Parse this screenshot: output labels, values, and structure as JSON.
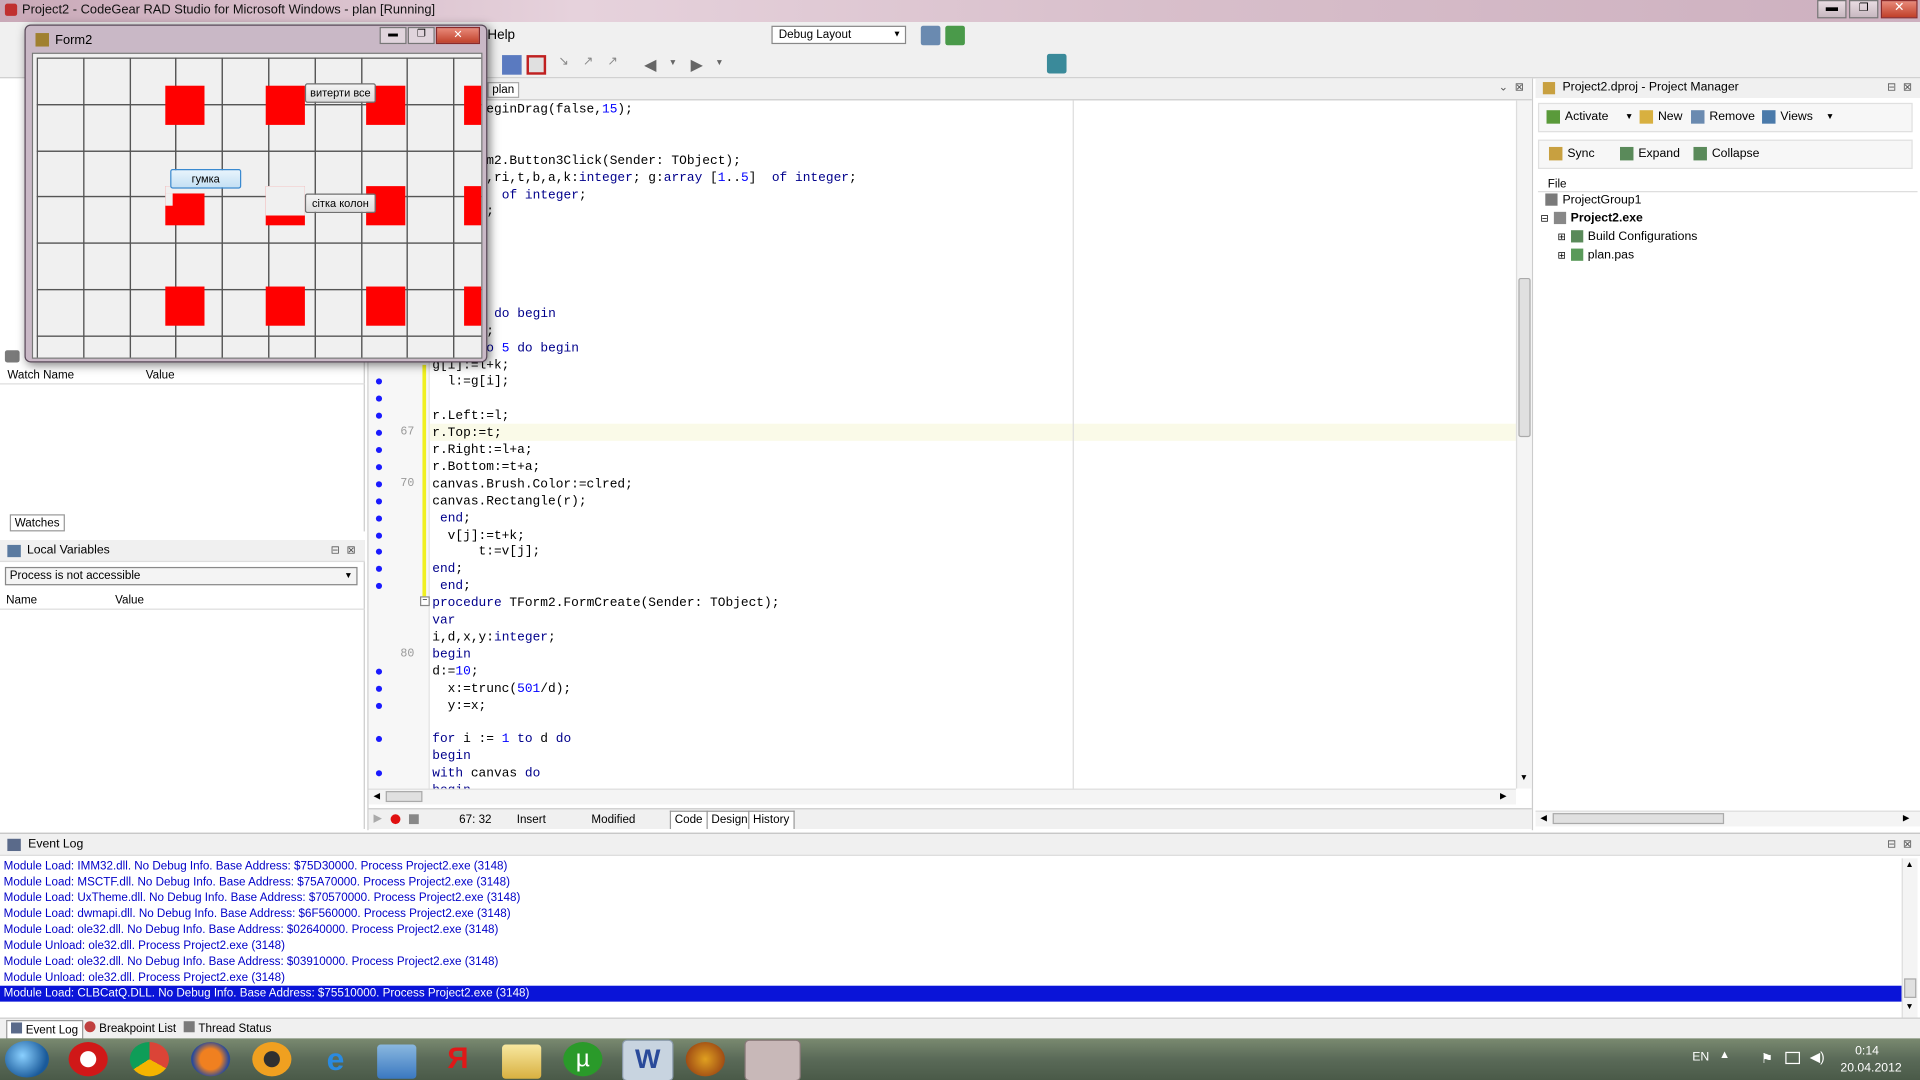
{
  "window": {
    "title": "Project2 - CodeGear RAD Studio for Microsoft Windows - plan [Running]"
  },
  "menu": {
    "help": "Help"
  },
  "toolbar": {
    "layout_select": "Debug Layout"
  },
  "form2": {
    "title": "Form2",
    "buttons": {
      "wipe_all": "витерти все",
      "rubber": "гумка",
      "grid_columns": "сітка колон"
    }
  },
  "editor": {
    "tab": "plan",
    "gutter_numbers": {
      "l67": "67",
      "l70": "70",
      "l80": "80"
    },
    "lines": [
      "tton2.BeginDrag(false,15);",
      "",
      "",
      "re TForm2.Button3Click(Sender: TObject);",
      "Rect; l,ri,t,b,a,k:integer; g:array [1..5]  of integer;",
      " [1..3]  of integer;",
      "Integer;",
      "",
      "",
      "",
      ";",
      "",
      " 1 to 3 do begin",
      "  l:=30;",
      "I:= 1 to 5 do begin",
      "g[i]:=l+k;",
      "  l:=g[i];",
      "",
      "r.Left:=l;",
      "r.Top:=t;",
      "r.Right:=l+a;",
      "r.Bottom:=t+a;",
      "canvas.Brush.Color:=clred;",
      "canvas.Rectangle(r);",
      " end;",
      "  v[j]:=t+k;",
      "      t:=v[j];",
      "end;",
      " end;",
      "procedure TForm2.FormCreate(Sender: TObject);",
      "var",
      "i,d,x,y:integer;",
      "begin",
      "d:=10;",
      "  x:=trunc(501/d);",
      "  y:=x;",
      "",
      "for i := 1 to d do",
      "begin",
      "with canvas do",
      "begin"
    ],
    "status": {
      "position": "67: 32",
      "mode": "Insert",
      "modified": "Modified"
    },
    "bottom_tabs": [
      "Code",
      "Design",
      "History"
    ]
  },
  "watches": {
    "columns": [
      "Watch Name",
      "Value"
    ],
    "tab": "Watches"
  },
  "local_vars": {
    "title": "Local Variables",
    "select": "Process is not accessible",
    "columns": [
      "Name",
      "Value"
    ]
  },
  "project_manager": {
    "title": "Project2.dproj - Project Manager",
    "toolbar1": [
      "Activate",
      "New",
      "Remove",
      "Views"
    ],
    "toolbar2": [
      "Sync",
      "Expand",
      "Collapse"
    ],
    "header": "File",
    "tree": [
      "ProjectGroup1",
      "Project2.exe",
      "Build Configurations",
      "plan.pas"
    ]
  },
  "event_log": {
    "title": "Event Log",
    "lines": [
      "Module Load: IMM32.dll. No Debug Info. Base Address: $75D30000. Process Project2.exe (3148)",
      "Module Load: MSCTF.dll. No Debug Info. Base Address: $75A70000. Process Project2.exe (3148)",
      "Module Load: UxTheme.dll. No Debug Info. Base Address: $70570000. Process Project2.exe (3148)",
      "Module Load: dwmapi.dll. No Debug Info. Base Address: $6F560000. Process Project2.exe (3148)",
      "Module Load: ole32.dll. No Debug Info. Base Address: $02640000. Process Project2.exe (3148)",
      "Module Unload: ole32.dll. Process Project2.exe (3148)",
      "Module Load: ole32.dll. No Debug Info. Base Address: $03910000. Process Project2.exe (3148)",
      "Module Unload: ole32.dll. Process Project2.exe (3148)",
      "Module Load: CLBCatQ.DLL. No Debug Info. Base Address: $75510000. Process Project2.exe (3148)"
    ],
    "tabs": [
      "Event Log",
      "Breakpoint List",
      "Thread Status"
    ]
  },
  "taskbar": {
    "lang": "EN",
    "time": "0:14",
    "date": "20.04.2012"
  },
  "colors": {
    "selection": "#0a14d8",
    "code_keyword": "#00008b",
    "code_number": "#0000ff",
    "breakpoint_dot": "#1a1aff"
  }
}
